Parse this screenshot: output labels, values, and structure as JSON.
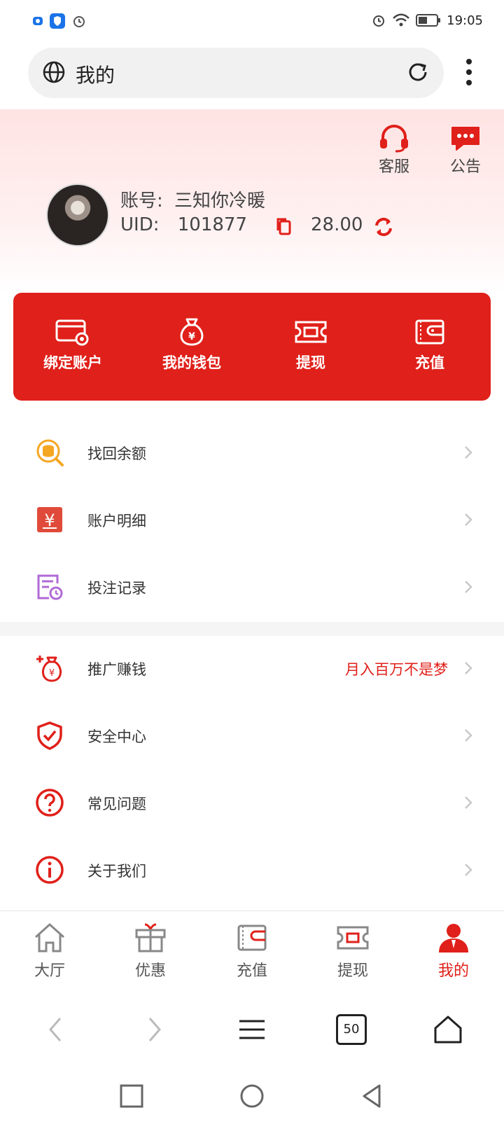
{
  "status_bar": {
    "time": "19:05"
  },
  "address_bar": {
    "title": "我的"
  },
  "header": {
    "customer_service_label": "客服",
    "announcement_label": "公告",
    "account_label": "账号:",
    "account_name": "三知你冷暖",
    "uid_label": "UID:",
    "uid_value": "101877",
    "balance": "28.00"
  },
  "quick_actions": [
    {
      "label": "绑定账户",
      "icon": "card-settings-icon"
    },
    {
      "label": "我的钱包",
      "icon": "money-bag-icon"
    },
    {
      "label": "提现",
      "icon": "ticket-icon"
    },
    {
      "label": "充值",
      "icon": "wallet-icon"
    }
  ],
  "menu_group1": [
    {
      "label": "找回余额",
      "icon": "coin-search-icon"
    },
    {
      "label": "账户明细",
      "icon": "yuan-doc-icon"
    },
    {
      "label": "投注记录",
      "icon": "bet-record-icon"
    }
  ],
  "menu_group2": [
    {
      "label": "推广赚钱",
      "icon": "promo-bag-icon",
      "extra": "月入百万不是梦"
    },
    {
      "label": "安全中心",
      "icon": "shield-check-icon"
    },
    {
      "label": "常见问题",
      "icon": "question-icon"
    },
    {
      "label": "关于我们",
      "icon": "info-icon"
    }
  ],
  "tab_bar": [
    {
      "label": "大厅",
      "icon": "home-icon"
    },
    {
      "label": "优惠",
      "icon": "gift-icon"
    },
    {
      "label": "充值",
      "icon": "wallet-icon"
    },
    {
      "label": "提现",
      "icon": "ticket-icon"
    },
    {
      "label": "我的",
      "icon": "user-icon",
      "active": true
    }
  ],
  "browser_nav": {
    "tab_count": "50"
  },
  "colors": {
    "accent": "#e0201a",
    "header_bg": "#ffe3e3"
  }
}
